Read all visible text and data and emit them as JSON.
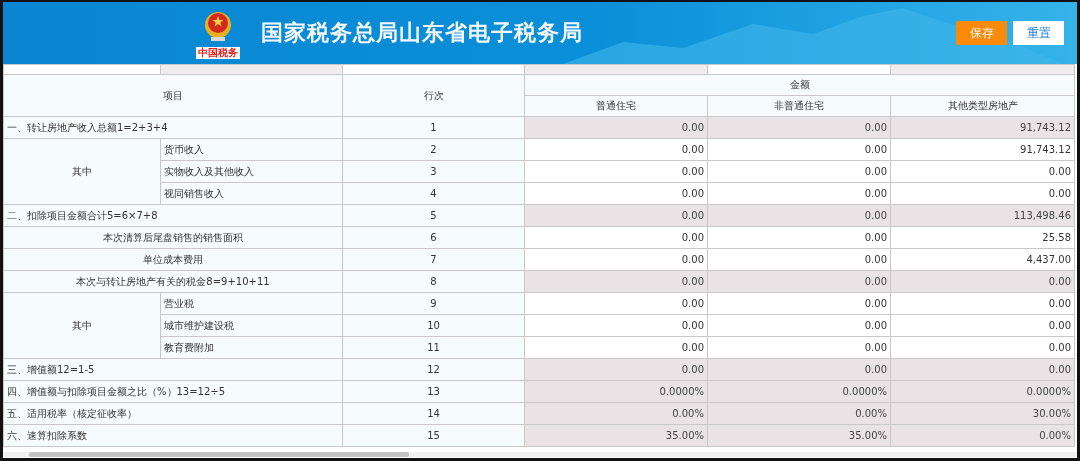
{
  "header": {
    "title": "国家税务总局山东省电子税务局",
    "emblem_caption": "中国税务",
    "buttons": [
      {
        "label": "保存",
        "kind": "primary"
      },
      {
        "label": "重置",
        "kind": "secondary"
      }
    ]
  },
  "table": {
    "amount_header": "金额",
    "columns": [
      "项目",
      "行次",
      "普通住宅",
      "非普通住宅",
      "其他类型房地产"
    ],
    "rows": [
      {
        "kind": "section",
        "label": "一、转让房地产收入总额1=2+3+4",
        "line": "1",
        "computed": true,
        "values": [
          "0.00",
          "0.00",
          "91,743.12"
        ]
      },
      {
        "kind": "group",
        "label": "其中",
        "items": [
          {
            "label": "货币收入",
            "line": "2",
            "computed": false,
            "values": [
              "0.00",
              "0.00",
              "91,743.12"
            ]
          },
          {
            "label": "实物收入及其他收入",
            "line": "3",
            "computed": false,
            "values": [
              "0.00",
              "0.00",
              "0.00"
            ]
          },
          {
            "label": "视同销售收入",
            "line": "4",
            "computed": false,
            "values": [
              "0.00",
              "0.00",
              "0.00"
            ]
          }
        ]
      },
      {
        "kind": "section",
        "label": "二、扣除项目金额合计5=6×7+8",
        "line": "5",
        "computed": true,
        "values": [
          "0.00",
          "0.00",
          "113,498.46"
        ]
      },
      {
        "kind": "centered",
        "label": "本次清算后尾盘销售的销售面积",
        "line": "6",
        "computed": false,
        "values": [
          "0.00",
          "0.00",
          "25.58"
        ]
      },
      {
        "kind": "centered",
        "label": "单位成本费用",
        "line": "7",
        "computed": false,
        "values": [
          "0.00",
          "0.00",
          "4,437.00"
        ]
      },
      {
        "kind": "centered",
        "label": "本次与转让房地产有关的税金8=9+10+11",
        "line": "8",
        "computed": true,
        "values": [
          "0.00",
          "0.00",
          "0.00"
        ]
      },
      {
        "kind": "group",
        "label": "其中",
        "items": [
          {
            "label": "营业税",
            "line": "9",
            "computed": false,
            "values": [
              "0.00",
              "0.00",
              "0.00"
            ]
          },
          {
            "label": "城市维护建设税",
            "line": "10",
            "computed": false,
            "values": [
              "0.00",
              "0.00",
              "0.00"
            ]
          },
          {
            "label": "教育费附加",
            "line": "11",
            "computed": false,
            "values": [
              "0.00",
              "0.00",
              "0.00"
            ]
          }
        ]
      },
      {
        "kind": "section",
        "label": "三、增值额12=1-5",
        "line": "12",
        "computed": true,
        "values": [
          "0.00",
          "0.00",
          "0.00"
        ]
      },
      {
        "kind": "section",
        "label": "四、增值额与扣除项目金额之比（%）13=12÷5",
        "line": "13",
        "computed": true,
        "values": [
          "0.0000%",
          "0.0000%",
          "0.0000%"
        ]
      },
      {
        "kind": "section",
        "label": "五、适用税率（核定征收率）",
        "line": "14",
        "computed": true,
        "values": [
          "0.00%",
          "0.00%",
          "30.00%"
        ]
      },
      {
        "kind": "section",
        "label": "六、速算扣除系数",
        "line": "15",
        "computed": true,
        "values": [
          "35.00%",
          "35.00%",
          "0.00%"
        ]
      }
    ]
  }
}
